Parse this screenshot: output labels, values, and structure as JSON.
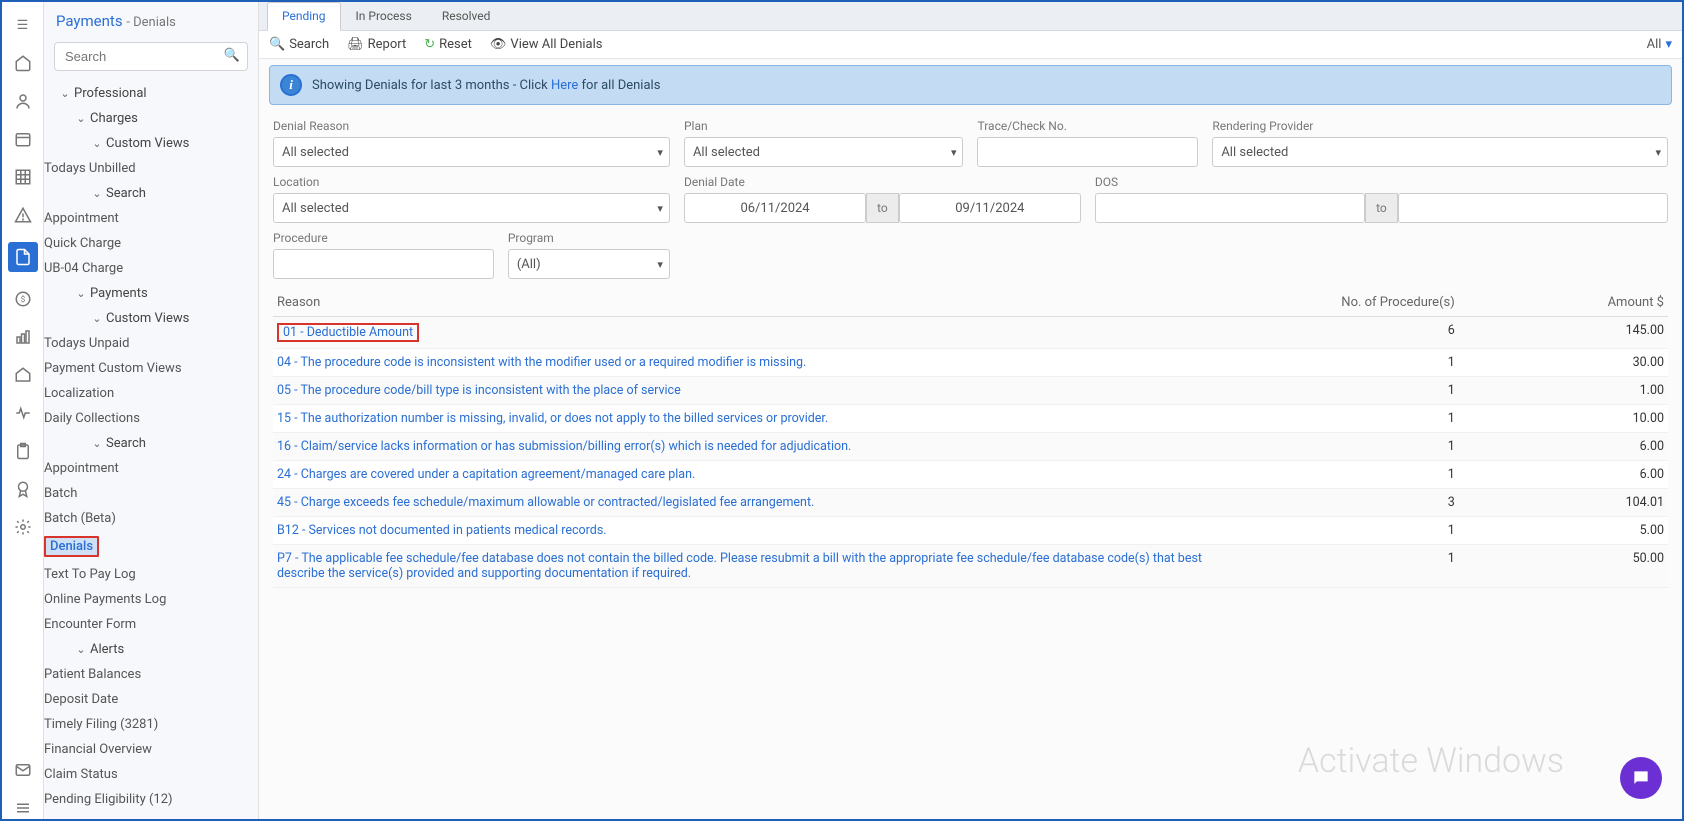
{
  "header": {
    "title": "Payments",
    "subtitle": "- Denials"
  },
  "search_placeholder": "Search",
  "nav": {
    "professional": "Professional",
    "charges": "Charges",
    "custom_views": "Custom Views",
    "todays_unbilled": "Todays Unbilled",
    "search": "Search",
    "appointment": "Appointment",
    "quick_charge": "Quick Charge",
    "ub04": "UB-04 Charge",
    "payments": "Payments",
    "todays_unpaid": "Todays Unpaid",
    "payment_custom_views": "Payment Custom Views",
    "localization": "Localization",
    "daily_collections": "Daily Collections",
    "batch": "Batch",
    "batch_beta": "Batch (Beta)",
    "denials": "Denials",
    "text_to_pay": "Text To Pay Log",
    "online_payments": "Online Payments Log",
    "encounter_form": "Encounter Form",
    "alerts": "Alerts",
    "patient_balances": "Patient Balances",
    "deposit_date": "Deposit Date",
    "timely_filing": "Timely Filing (3281)",
    "financial_overview": "Financial Overview",
    "claim_status": "Claim Status",
    "pending_eligibility": "Pending Eligibility (12)"
  },
  "tabs": {
    "pending": "Pending",
    "in_process": "In Process",
    "resolved": "Resolved"
  },
  "toolbar": {
    "search": "Search",
    "report": "Report",
    "reset": "Reset",
    "view_all": "View All Denials",
    "all": "All"
  },
  "banner": {
    "pre": "Showing Denials for last 3 months - Click ",
    "link": "Here",
    "post": " for all Denials"
  },
  "filters": {
    "denial_reason": {
      "label": "Denial Reason",
      "value": "All selected"
    },
    "plan": {
      "label": "Plan",
      "value": "All selected"
    },
    "trace": {
      "label": "Trace/Check No."
    },
    "rendering": {
      "label": "Rendering Provider",
      "value": "All selected"
    },
    "location": {
      "label": "Location",
      "value": "All selected"
    },
    "denial_date": {
      "label": "Denial Date",
      "from": "06/11/2024",
      "to_label": "to",
      "to": "09/11/2024"
    },
    "dos": {
      "label": "DOS",
      "to_label": "to"
    },
    "procedure": {
      "label": "Procedure"
    },
    "program": {
      "label": "Program",
      "value": "(All)"
    }
  },
  "table": {
    "headers": {
      "reason": "Reason",
      "procs": "No. of Procedure(s)",
      "amount": "Amount $"
    },
    "rows": [
      {
        "reason": "01 - Deductible Amount",
        "procs": "6",
        "amount": "145.00",
        "highlight": true
      },
      {
        "reason": "04 - The procedure code is inconsistent with the modifier used or a required modifier is missing.",
        "procs": "1",
        "amount": "30.00"
      },
      {
        "reason": "05 - The procedure code/bill type is inconsistent with the place of service",
        "procs": "1",
        "amount": "1.00"
      },
      {
        "reason": "15 - The authorization number is missing, invalid, or does not apply to the billed services or provider.",
        "procs": "1",
        "amount": "10.00"
      },
      {
        "reason": "16 - Claim/service lacks information or has submission/billing error(s) which is needed for adjudication.",
        "procs": "1",
        "amount": "6.00"
      },
      {
        "reason": "24 - Charges are covered under a capitation agreement/managed care plan.",
        "procs": "1",
        "amount": "6.00"
      },
      {
        "reason": "45 - Charge exceeds fee schedule/maximum allowable or contracted/legislated fee arrangement.",
        "procs": "3",
        "amount": "104.01"
      },
      {
        "reason": "B12 - Services not documented in patients medical records.",
        "procs": "1",
        "amount": "5.00"
      },
      {
        "reason": "P7 - The applicable fee schedule/fee database does not contain the billed code. Please resubmit a bill with the appropriate fee schedule/fee database code(s) that best describe the service(s) provided and supporting documentation if required.",
        "procs": "1",
        "amount": "50.00"
      }
    ]
  },
  "watermark": "Activate Windows"
}
